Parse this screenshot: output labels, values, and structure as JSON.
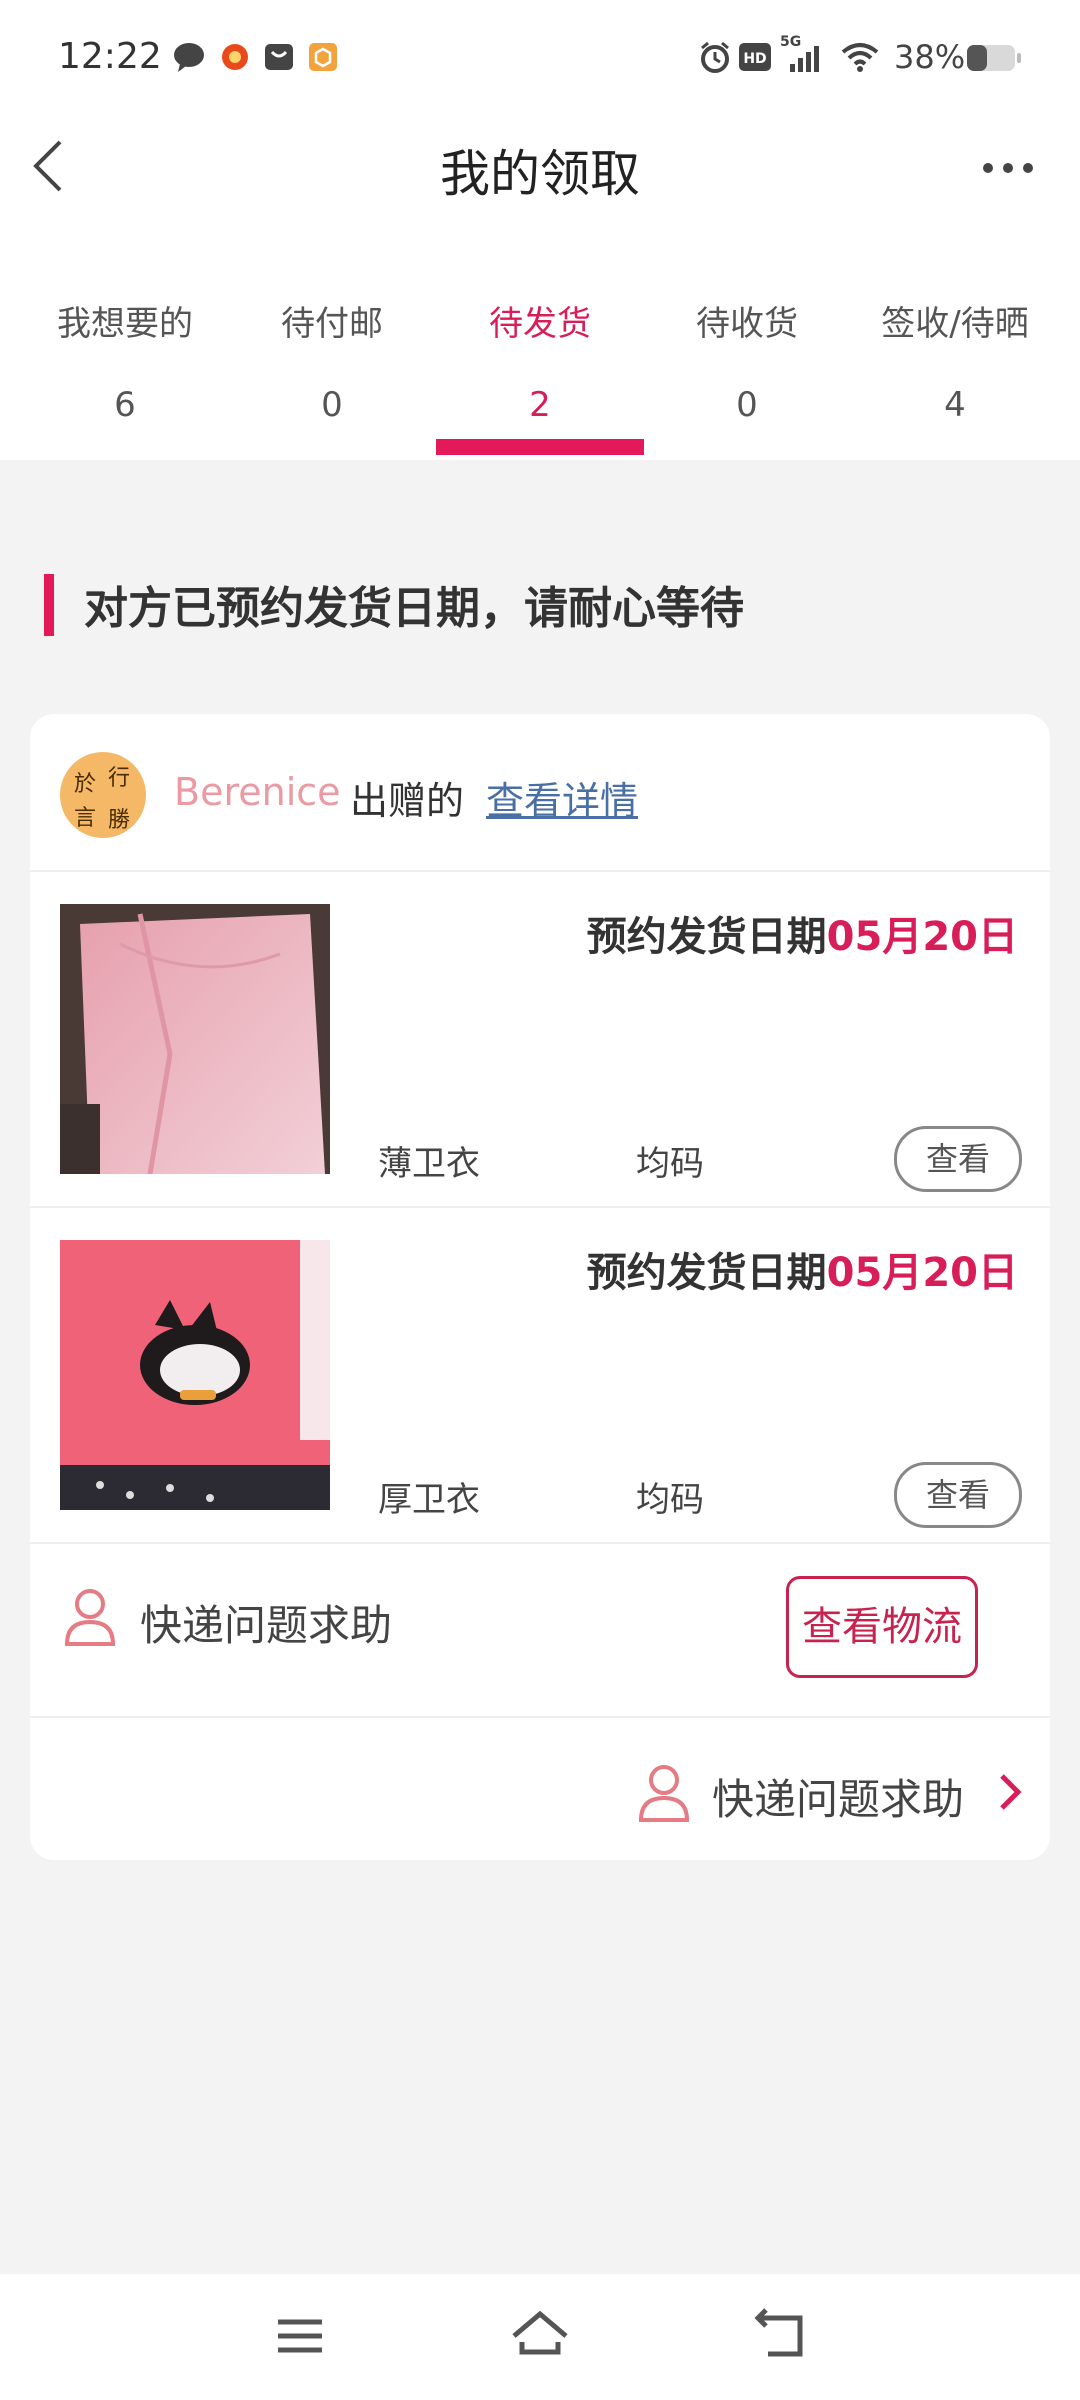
{
  "status_bar": {
    "time": "12:22",
    "network": "5G",
    "battery": "38%"
  },
  "header": {
    "title": "我的领取"
  },
  "tabs": [
    {
      "label": "我想要的",
      "count": "6"
    },
    {
      "label": "待付邮",
      "count": "0"
    },
    {
      "label": "待发货",
      "count": "2",
      "active": true
    },
    {
      "label": "待收货",
      "count": "0"
    },
    {
      "label": "签收/待晒",
      "count": "4"
    }
  ],
  "notice": "对方已预约发货日期，请耐心等待",
  "order": {
    "donor_name": "Berenice",
    "donor_action": "出赠的",
    "detail_link": "查看详情",
    "avatar_text": [
      "於",
      "行",
      "言",
      "勝"
    ],
    "items": [
      {
        "ship_label": "预约发货日期",
        "ship_date": "05月20日",
        "name": "薄卫衣",
        "size": "均码",
        "view_label": "查看",
        "photo_color": "#e8a7b6"
      },
      {
        "ship_label": "预约发货日期",
        "ship_date": "05月20日",
        "name": "厚卫衣",
        "size": "均码",
        "view_label": "查看",
        "photo_color": "#f06277"
      }
    ],
    "help_label": "快递问题求助",
    "logistics_label": "查看物流",
    "help_label_2": "快递问题求助"
  },
  "colors": {
    "accent": "#e3195a",
    "accent_text": "#d81e58",
    "link": "#4a6fa5"
  }
}
